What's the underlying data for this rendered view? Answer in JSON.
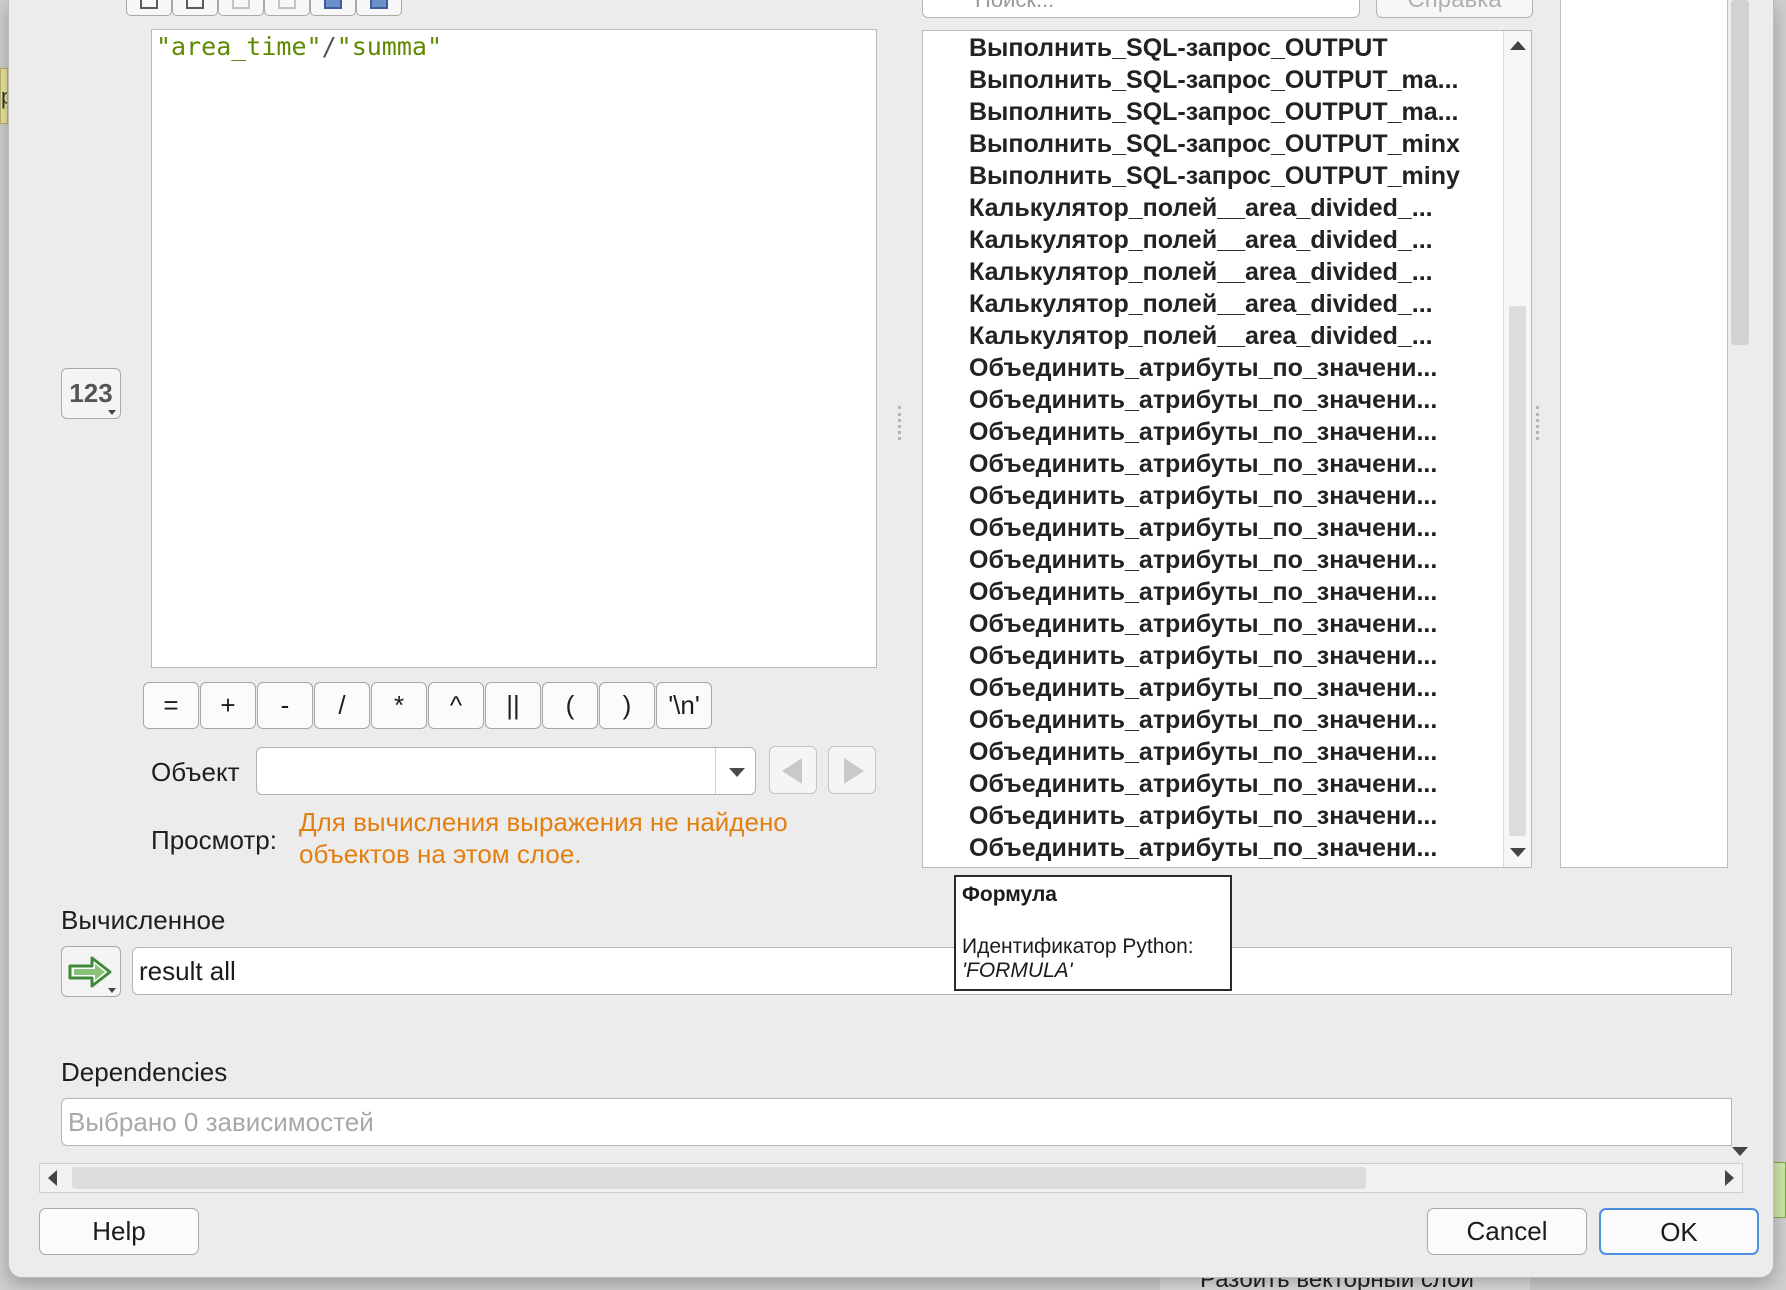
{
  "background": {
    "left_chip_text": "р",
    "bottom_task_label": "Разбить векторный слой"
  },
  "toolbar": {
    "search_placeholder": "Поиск...",
    "help_label": "Справка"
  },
  "editor": {
    "expr_field1": "\"area_time\"",
    "expr_operator": "/",
    "expr_field2": "\"summa\""
  },
  "number_button_label": "123",
  "operators": [
    "=",
    "+",
    "-",
    "/",
    "*",
    "^",
    "||",
    "(",
    ")",
    "'\\n'"
  ],
  "object": {
    "label": "Объект",
    "value": ""
  },
  "preview": {
    "label": "Просмотр:",
    "message_line1": "Для вычисления выражения не найдено",
    "message_line2": "объектов на этом слое."
  },
  "function_list": [
    "Выполнить_SQL-запрос_OUTPUT",
    "Выполнить_SQL-запрос_OUTPUT_ma...",
    "Выполнить_SQL-запрос_OUTPUT_ma...",
    "Выполнить_SQL-запрос_OUTPUT_minx",
    "Выполнить_SQL-запрос_OUTPUT_miny",
    "Калькулятор_полей__area_divided_...",
    "Калькулятор_полей__area_divided_...",
    "Калькулятор_полей__area_divided_...",
    "Калькулятор_полей__area_divided_...",
    "Калькулятор_полей__area_divided_...",
    "Объединить_атрибуты_по_значени...",
    "Объединить_атрибуты_по_значени...",
    "Объединить_атрибуты_по_значени...",
    "Объединить_атрибуты_по_значени...",
    "Объединить_атрибуты_по_значени...",
    "Объединить_атрибуты_по_значени...",
    "Объединить_атрибуты_по_значени...",
    "Объединить_атрибуты_по_значени...",
    "Объединить_атрибуты_по_значени...",
    "Объединить_атрибуты_по_значени...",
    "Объединить_атрибуты_по_значени...",
    "Объединить_атрибуты_по_значени...",
    "Объединить_атрибуты_по_значени...",
    "Объединить_атрибуты_по_значени...",
    "Объединить_атрибуты_по_значени...",
    "Объединить_атрибуты_по_значени..."
  ],
  "tooltip": {
    "title": "Формула",
    "id_label": "Идентификатор Python:",
    "id_value": "'FORMULA'"
  },
  "calculated": {
    "label": "Вычисленное",
    "value": "result all"
  },
  "dependencies": {
    "label": "Dependencies",
    "placeholder": "Выбрано 0 зависимостей"
  },
  "buttons": {
    "help": "Help",
    "cancel": "Cancel",
    "ok": "OK"
  },
  "colors": {
    "preview_warning": "#e37f10",
    "expression_field": "#5e8a00",
    "ok_focus": "#4f8fe2"
  }
}
